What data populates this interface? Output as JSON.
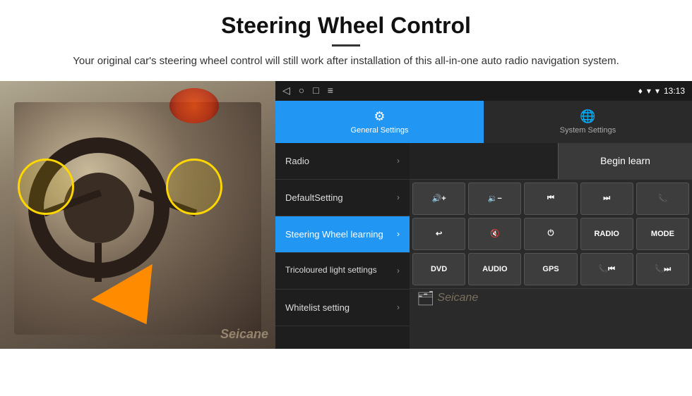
{
  "page": {
    "title": "Steering Wheel Control",
    "divider": "—",
    "subtitle": "Your original car's steering wheel control will still work after installation of this all-in-one auto radio navigation system."
  },
  "status_bar": {
    "nav_back": "◁",
    "nav_home": "○",
    "nav_recent": "□",
    "nav_menu": "≡",
    "wifi_icon": "▼",
    "signal_icon": "▼",
    "time": "13:13",
    "location_icon": "♦"
  },
  "tabs": [
    {
      "id": "general",
      "icon": "⚙",
      "label": "General Settings",
      "active": true
    },
    {
      "id": "system",
      "icon": "⊕",
      "label": "System Settings",
      "active": false
    }
  ],
  "menu": [
    {
      "id": "radio",
      "label": "Radio",
      "active": false
    },
    {
      "id": "default",
      "label": "DefaultSetting",
      "active": false
    },
    {
      "id": "steering",
      "label": "Steering Wheel learning",
      "active": true
    },
    {
      "id": "tricoloured",
      "label": "Tricoloured light settings",
      "active": false
    },
    {
      "id": "whitelist",
      "label": "Whitelist setting",
      "active": false
    }
  ],
  "controls": {
    "begin_learn_label": "Begin learn",
    "buttons": [
      [
        {
          "id": "vol_up",
          "label": "🔊+",
          "type": "icon"
        },
        {
          "id": "vol_down",
          "label": "🔉−",
          "type": "icon"
        },
        {
          "id": "prev_track",
          "label": "⏮",
          "type": "icon"
        },
        {
          "id": "next_track",
          "label": "⏭",
          "type": "icon"
        },
        {
          "id": "phone",
          "label": "📞",
          "type": "icon"
        }
      ],
      [
        {
          "id": "call_end",
          "label": "↩",
          "type": "icon"
        },
        {
          "id": "mute",
          "label": "🔇×",
          "type": "icon"
        },
        {
          "id": "power",
          "label": "⏻",
          "type": "icon"
        },
        {
          "id": "radio_btn",
          "label": "RADIO",
          "type": "text"
        },
        {
          "id": "mode_btn",
          "label": "MODE",
          "type": "text"
        }
      ],
      [
        {
          "id": "dvd_btn",
          "label": "DVD",
          "type": "text"
        },
        {
          "id": "audio_btn",
          "label": "AUDIO",
          "type": "text"
        },
        {
          "id": "gps_btn",
          "label": "GPS",
          "type": "text"
        },
        {
          "id": "prev2",
          "label": "📞⏮",
          "type": "icon"
        },
        {
          "id": "next2",
          "label": "📞⏭",
          "type": "icon"
        }
      ]
    ]
  },
  "watermark": "Seicane"
}
